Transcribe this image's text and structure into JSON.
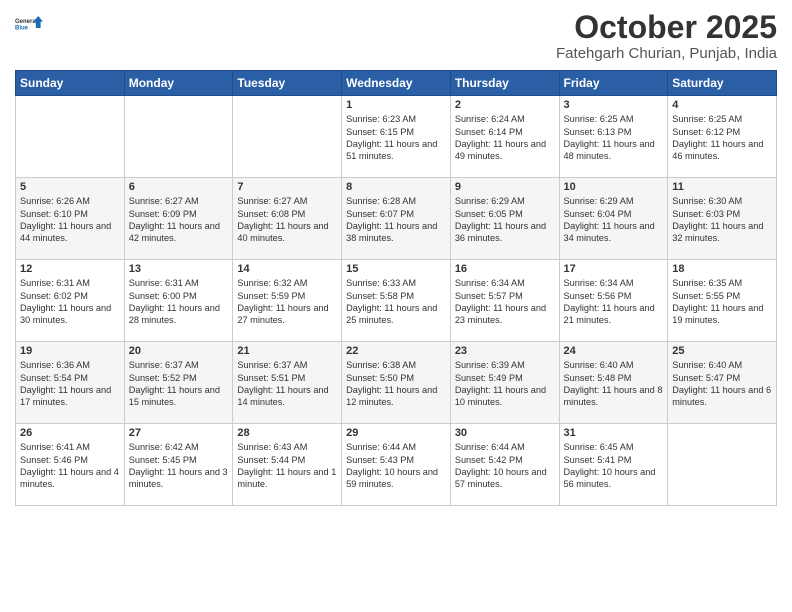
{
  "logo": {
    "line1": "General",
    "line2": "Blue"
  },
  "title": "October 2025",
  "location": "Fatehgarh Churian, Punjab, India",
  "days_of_week": [
    "Sunday",
    "Monday",
    "Tuesday",
    "Wednesday",
    "Thursday",
    "Friday",
    "Saturday"
  ],
  "weeks": [
    [
      {
        "day": "",
        "text": ""
      },
      {
        "day": "",
        "text": ""
      },
      {
        "day": "",
        "text": ""
      },
      {
        "day": "1",
        "text": "Sunrise: 6:23 AM\nSunset: 6:15 PM\nDaylight: 11 hours\nand 51 minutes."
      },
      {
        "day": "2",
        "text": "Sunrise: 6:24 AM\nSunset: 6:14 PM\nDaylight: 11 hours\nand 49 minutes."
      },
      {
        "day": "3",
        "text": "Sunrise: 6:25 AM\nSunset: 6:13 PM\nDaylight: 11 hours\nand 48 minutes."
      },
      {
        "day": "4",
        "text": "Sunrise: 6:25 AM\nSunset: 6:12 PM\nDaylight: 11 hours\nand 46 minutes."
      }
    ],
    [
      {
        "day": "5",
        "text": "Sunrise: 6:26 AM\nSunset: 6:10 PM\nDaylight: 11 hours\nand 44 minutes."
      },
      {
        "day": "6",
        "text": "Sunrise: 6:27 AM\nSunset: 6:09 PM\nDaylight: 11 hours\nand 42 minutes."
      },
      {
        "day": "7",
        "text": "Sunrise: 6:27 AM\nSunset: 6:08 PM\nDaylight: 11 hours\nand 40 minutes."
      },
      {
        "day": "8",
        "text": "Sunrise: 6:28 AM\nSunset: 6:07 PM\nDaylight: 11 hours\nand 38 minutes."
      },
      {
        "day": "9",
        "text": "Sunrise: 6:29 AM\nSunset: 6:05 PM\nDaylight: 11 hours\nand 36 minutes."
      },
      {
        "day": "10",
        "text": "Sunrise: 6:29 AM\nSunset: 6:04 PM\nDaylight: 11 hours\nand 34 minutes."
      },
      {
        "day": "11",
        "text": "Sunrise: 6:30 AM\nSunset: 6:03 PM\nDaylight: 11 hours\nand 32 minutes."
      }
    ],
    [
      {
        "day": "12",
        "text": "Sunrise: 6:31 AM\nSunset: 6:02 PM\nDaylight: 11 hours\nand 30 minutes."
      },
      {
        "day": "13",
        "text": "Sunrise: 6:31 AM\nSunset: 6:00 PM\nDaylight: 11 hours\nand 28 minutes."
      },
      {
        "day": "14",
        "text": "Sunrise: 6:32 AM\nSunset: 5:59 PM\nDaylight: 11 hours\nand 27 minutes."
      },
      {
        "day": "15",
        "text": "Sunrise: 6:33 AM\nSunset: 5:58 PM\nDaylight: 11 hours\nand 25 minutes."
      },
      {
        "day": "16",
        "text": "Sunrise: 6:34 AM\nSunset: 5:57 PM\nDaylight: 11 hours\nand 23 minutes."
      },
      {
        "day": "17",
        "text": "Sunrise: 6:34 AM\nSunset: 5:56 PM\nDaylight: 11 hours\nand 21 minutes."
      },
      {
        "day": "18",
        "text": "Sunrise: 6:35 AM\nSunset: 5:55 PM\nDaylight: 11 hours\nand 19 minutes."
      }
    ],
    [
      {
        "day": "19",
        "text": "Sunrise: 6:36 AM\nSunset: 5:54 PM\nDaylight: 11 hours\nand 17 minutes."
      },
      {
        "day": "20",
        "text": "Sunrise: 6:37 AM\nSunset: 5:52 PM\nDaylight: 11 hours\nand 15 minutes."
      },
      {
        "day": "21",
        "text": "Sunrise: 6:37 AM\nSunset: 5:51 PM\nDaylight: 11 hours\nand 14 minutes."
      },
      {
        "day": "22",
        "text": "Sunrise: 6:38 AM\nSunset: 5:50 PM\nDaylight: 11 hours\nand 12 minutes."
      },
      {
        "day": "23",
        "text": "Sunrise: 6:39 AM\nSunset: 5:49 PM\nDaylight: 11 hours\nand 10 minutes."
      },
      {
        "day": "24",
        "text": "Sunrise: 6:40 AM\nSunset: 5:48 PM\nDaylight: 11 hours\nand 8 minutes."
      },
      {
        "day": "25",
        "text": "Sunrise: 6:40 AM\nSunset: 5:47 PM\nDaylight: 11 hours\nand 6 minutes."
      }
    ],
    [
      {
        "day": "26",
        "text": "Sunrise: 6:41 AM\nSunset: 5:46 PM\nDaylight: 11 hours\nand 4 minutes."
      },
      {
        "day": "27",
        "text": "Sunrise: 6:42 AM\nSunset: 5:45 PM\nDaylight: 11 hours\nand 3 minutes."
      },
      {
        "day": "28",
        "text": "Sunrise: 6:43 AM\nSunset: 5:44 PM\nDaylight: 11 hours\nand 1 minute."
      },
      {
        "day": "29",
        "text": "Sunrise: 6:44 AM\nSunset: 5:43 PM\nDaylight: 10 hours\nand 59 minutes."
      },
      {
        "day": "30",
        "text": "Sunrise: 6:44 AM\nSunset: 5:42 PM\nDaylight: 10 hours\nand 57 minutes."
      },
      {
        "day": "31",
        "text": "Sunrise: 6:45 AM\nSunset: 5:41 PM\nDaylight: 10 hours\nand 56 minutes."
      },
      {
        "day": "",
        "text": ""
      }
    ]
  ]
}
